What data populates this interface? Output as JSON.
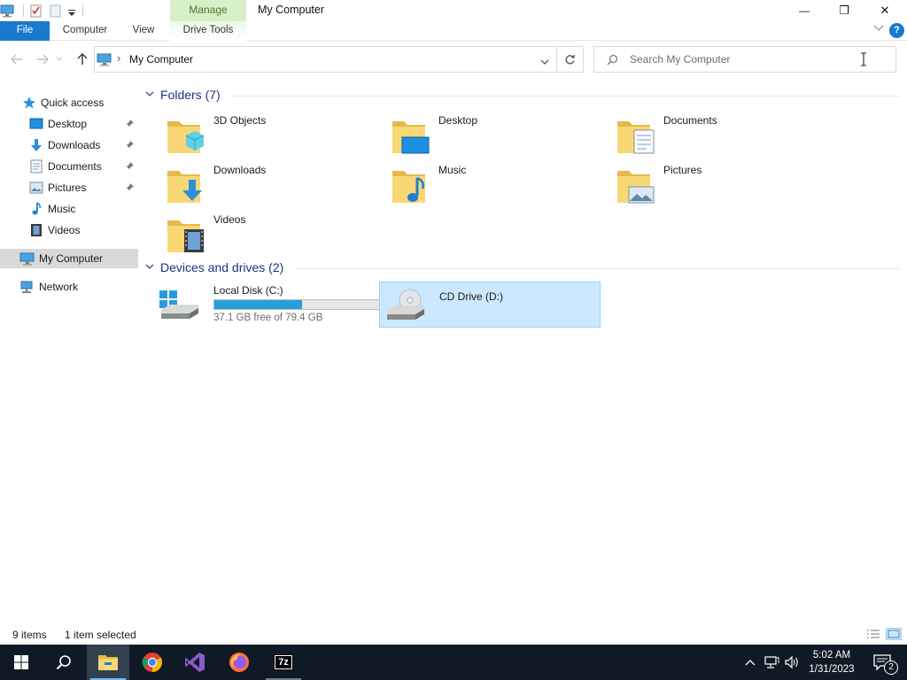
{
  "window": {
    "title": "My Computer",
    "context_tab": "Manage",
    "minimize_glyph": "—",
    "restore_glyph": "❐",
    "close_glyph": "✕"
  },
  "ribbon": {
    "tabs": [
      "File",
      "Computer",
      "View",
      "Drive Tools"
    ],
    "help_label": "?"
  },
  "address": {
    "path": "My Computer",
    "separator": "›",
    "search_placeholder": "Search My Computer"
  },
  "nav": {
    "quick_access": "Quick access",
    "pinned": [
      {
        "label": "Desktop",
        "icon": "desktop-icon"
      },
      {
        "label": "Downloads",
        "icon": "downloads-icon"
      },
      {
        "label": "Documents",
        "icon": "documents-icon"
      },
      {
        "label": "Pictures",
        "icon": "pictures-icon"
      }
    ],
    "other": [
      {
        "label": "Music",
        "icon": "music-icon"
      },
      {
        "label": "Videos",
        "icon": "videos-icon"
      }
    ],
    "my_computer": "My Computer",
    "network": "Network"
  },
  "groups": {
    "folders_header": "Folders (7)",
    "devices_header": "Devices and drives (2)"
  },
  "folders": [
    {
      "label": "3D Objects",
      "icon": "3d-objects-icon"
    },
    {
      "label": "Desktop",
      "icon": "desktop-folder-icon"
    },
    {
      "label": "Documents",
      "icon": "documents-folder-icon"
    },
    {
      "label": "Downloads",
      "icon": "downloads-folder-icon"
    },
    {
      "label": "Music",
      "icon": "music-folder-icon"
    },
    {
      "label": "Pictures",
      "icon": "pictures-folder-icon"
    },
    {
      "label": "Videos",
      "icon": "videos-folder-icon"
    }
  ],
  "drives": [
    {
      "label": "Local Disk (C:)",
      "detail": "37.1 GB free of 79.4 GB",
      "used_fraction": 0.533,
      "icon": "local-disk-icon"
    },
    {
      "label": "CD Drive (D:)",
      "icon": "cd-drive-icon"
    }
  ],
  "status": {
    "item_count": "9 items",
    "selection": "1 item selected"
  },
  "taskbar": {
    "apps": [
      "start-icon",
      "search-icon",
      "file-explorer-icon",
      "chrome-icon",
      "visual-studio-icon",
      "firefox-icon",
      "7zip-icon"
    ],
    "sevenzip_label": "7z",
    "time": "5:02 AM",
    "date": "1/31/2023",
    "notification_count": "2"
  },
  "colors": {
    "accent": "#1979ca",
    "manage_tab": "#d6f0c9",
    "selection": "#cce8ff",
    "drive_bar": "#26a0da",
    "taskbar": "#101a26"
  }
}
